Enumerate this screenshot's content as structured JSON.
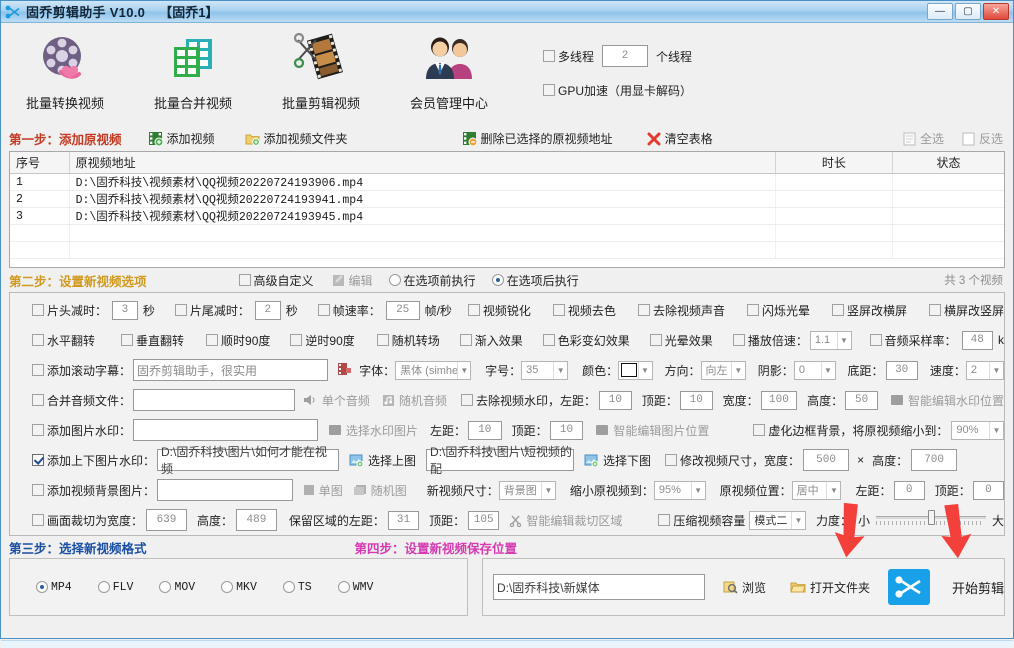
{
  "window": {
    "title": "固乔剪辑助手 V10.0",
    "subtitle": "【固乔1】",
    "minimize": "—",
    "maximize": "▢",
    "close": "✕"
  },
  "toolbar": {
    "items": [
      {
        "label": "批量转换视频",
        "icon": "film-reel-icon"
      },
      {
        "label": "批量合并视频",
        "icon": "merge-grid-icon"
      },
      {
        "label": "批量剪辑视频",
        "icon": "film-scissors-icon"
      },
      {
        "label": "会员管理中心",
        "icon": "members-icon"
      }
    ],
    "multithread_label": "多线程",
    "multithread_value": "2",
    "multithread_suffix": "个线程",
    "gpu_label": "GPU加速（用显卡解码）"
  },
  "step1": {
    "title": "第一步：添加原视频",
    "add_video": "添加视频",
    "add_folder": "添加视频文件夹",
    "delete_selected": "删除已选择的原视频地址",
    "clear_table": "清空表格",
    "select_all": "全选",
    "invert_select": "反选"
  },
  "table": {
    "columns": [
      "序号",
      "原视频地址",
      "时长",
      "状态"
    ],
    "rows": [
      {
        "idx": "1",
        "path": "D:\\固乔科技\\视频素材\\QQ视频20220724193906.mp4",
        "dur": "",
        "state": ""
      },
      {
        "idx": "2",
        "path": "D:\\固乔科技\\视频素材\\QQ视频20220724193941.mp4",
        "dur": "",
        "state": ""
      },
      {
        "idx": "3",
        "path": "D:\\固乔科技\\视频素材\\QQ视频20220724193945.mp4",
        "dur": "",
        "state": ""
      }
    ]
  },
  "step2": {
    "title": "第二步：设置新视频选项",
    "advanced_custom": "高级自定义",
    "edit": "编辑",
    "before_option": "在选项前执行",
    "after_option": "在选项后执行",
    "count_text": "共 3 个视频"
  },
  "options": {
    "row1": {
      "head_trim_label": "片头减时：",
      "head_trim_value": "3",
      "head_trim_unit": "秒",
      "tail_trim_label": "片尾减时：",
      "tail_trim_value": "2",
      "tail_trim_unit": "秒",
      "fps_label": "帧速率：",
      "fps_value": "25",
      "fps_unit": "帧/秒",
      "sharpen": "视频锐化",
      "decolor": "视频去色",
      "remove_audio": "去除视频声音",
      "flicker_halo": "闪烁光晕",
      "v2h": "竖屏改横屏",
      "h2v": "横屏改竖屏"
    },
    "row2": {
      "flip_h": "水平翻转",
      "flip_v": "垂直翻转",
      "rot_cw": "顺时90度",
      "rot_ccw": "逆时90度",
      "random_transition": "随机转场",
      "fade_in": "渐入效果",
      "color_shift": "色彩变幻效果",
      "halo_effect": "光晕效果",
      "speed_label": "播放倍速：",
      "speed_value": "1.1",
      "samplerate_label": "音频采样率：",
      "samplerate_value": "48",
      "samplerate_unit": "k"
    },
    "row3": {
      "subtitle_label": "添加滚动字幕：",
      "subtitle_value": "固乔剪辑助手，很实用",
      "font_label": "字体：",
      "font_value": "黑体 (simhei)",
      "size_label": "字号：",
      "size_value": "35",
      "color_label": "颜色：",
      "dir_label": "方向：",
      "dir_value": "向左",
      "shadow_label": "阴影：",
      "shadow_value": "0",
      "bottom_label": "底距：",
      "bottom_value": "30",
      "speed_label": "速度：",
      "speed_value": "2"
    },
    "row4": {
      "merge_audio_label": "合并音频文件：",
      "merge_audio_value": "",
      "single_audio": "单个音频",
      "random_audio": "随机音频",
      "remove_watermark": "去除视频水印，左距：",
      "left_value": "10",
      "top_label": "顶距：",
      "top_value": "10",
      "width_label": "宽度：",
      "width_value": "100",
      "height_label": "高度：",
      "height_value": "50",
      "smart_edit_wm": "智能编辑水印位置"
    },
    "row5": {
      "image_wm_label": "添加图片水印：",
      "image_wm_value": "",
      "choose_wm_img": "选择水印图片",
      "left_label": "左距：",
      "left_value": "10",
      "top_label": "顶距：",
      "top_value": "10",
      "smart_edit_img": "智能编辑图片位置",
      "blur_border": "虚化边框背景，将原视频缩小到：",
      "blur_value": "90%"
    },
    "row6": {
      "tb_wm_label": "添加上下图片水印：",
      "top_img_value": "D:\\固乔科技\\图片\\如何才能在视频",
      "choose_top": "选择上图",
      "bottom_img_value": "D:\\固乔科技\\图片\\短视频的配",
      "choose_bottom": "选择下图",
      "resize_label": "修改视频尺寸，宽度：",
      "resize_w": "500",
      "times": "×",
      "resize_h_label": "高度：",
      "resize_h": "700"
    },
    "row7": {
      "bg_img_label": "添加视频背景图片：",
      "bg_img_value": "",
      "single_img": "单图",
      "random_img": "随机图",
      "new_size_label": "新视频尺寸：",
      "new_size_value": "背景图",
      "shrink_label": "缩小原视频到：",
      "shrink_value": "95%",
      "pos_label": "原视频位置：",
      "pos_value": "居中",
      "left_label": "左距：",
      "left_value": "0",
      "top_label": "顶距：",
      "top_value": "0"
    },
    "row8": {
      "crop_label": "画面裁切为宽度：",
      "crop_w": "639",
      "crop_h_label": "高度：",
      "crop_h": "489",
      "keep_left_label": "保留区域的左距：",
      "keep_left": "31",
      "keep_top_label": "顶距：",
      "keep_top": "105",
      "smart_crop": "智能编辑裁切区域",
      "compress_label": "压缩视频容量",
      "mode_value": "模式二",
      "strength_label": "力度：",
      "strength_min": "小",
      "strength_max": "大"
    }
  },
  "step3": {
    "title": "第三步：选择新视频格式",
    "formats": [
      {
        "label": "MP4",
        "selected": true
      },
      {
        "label": "FLV",
        "selected": false
      },
      {
        "label": "MOV",
        "selected": false
      },
      {
        "label": "MKV",
        "selected": false
      },
      {
        "label": "TS",
        "selected": false
      },
      {
        "label": "WMV",
        "selected": false
      }
    ]
  },
  "step4": {
    "title": "第四步：设置新视频保存位置",
    "save_path": "D:\\固乔科技\\新媒体",
    "browse": "浏览",
    "open_folder": "打开文件夹",
    "start_label": "开始剪辑"
  },
  "colors": {
    "title_bar": "#8fc4ea",
    "step1": "#c43b23",
    "step2": "#d19a1e",
    "step3": "#1a4fa3",
    "step4": "#d63ab0",
    "accent": "#18a0e8",
    "arrow": "#f4403a"
  }
}
